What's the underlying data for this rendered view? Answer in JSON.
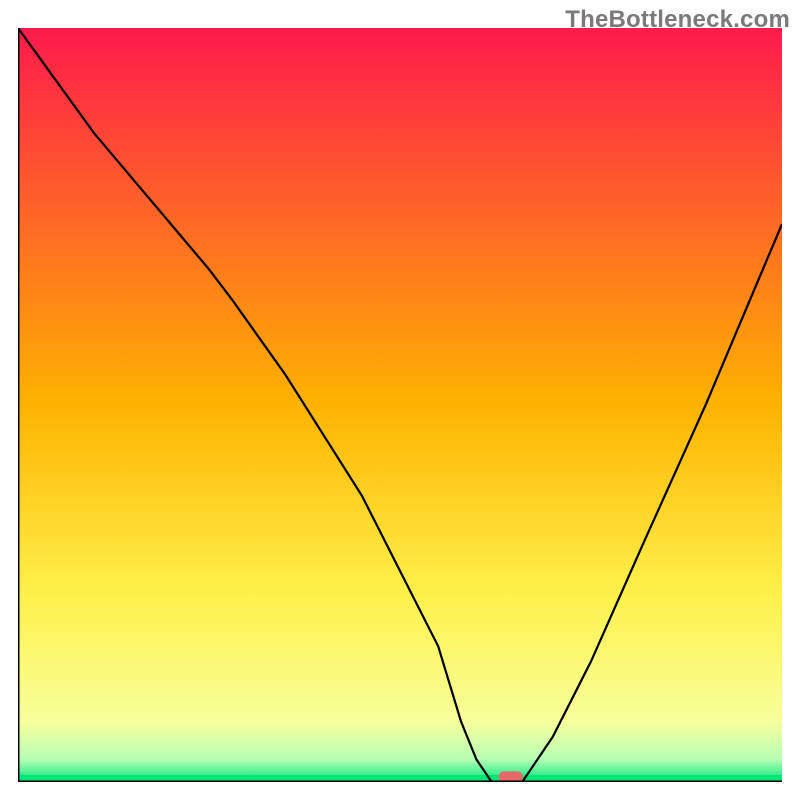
{
  "watermark": "TheBottleneck.com",
  "chart_data": {
    "type": "line",
    "title": "",
    "xlabel": "",
    "ylabel": "",
    "xlim": [
      0,
      100
    ],
    "ylim": [
      0,
      100
    ],
    "grid": false,
    "legend": false,
    "background": {
      "type": "vertical-gradient",
      "stops": [
        {
          "pos": 0.0,
          "color": "#ff1a4c"
        },
        {
          "pos": 0.5,
          "color": "#ffb300"
        },
        {
          "pos": 0.75,
          "color": "#fff14a"
        },
        {
          "pos": 0.92,
          "color": "#f7ff9c"
        },
        {
          "pos": 0.97,
          "color": "#b6ffb6"
        },
        {
          "pos": 1.0,
          "color": "#00e676"
        }
      ]
    },
    "series": [
      {
        "name": "bottleneck-curve",
        "color": "#000000",
        "x": [
          0,
          5,
          10,
          15,
          20,
          25,
          28,
          35,
          45,
          55,
          58,
          60,
          62,
          63,
          66,
          70,
          75,
          82,
          90,
          100
        ],
        "y": [
          100,
          93,
          86,
          80,
          74,
          68,
          64,
          54,
          38,
          18,
          8,
          3,
          0,
          0,
          0,
          6,
          16,
          32,
          50,
          74
        ]
      }
    ],
    "marker": {
      "name": "optimal-marker",
      "x": 64.5,
      "y": 0,
      "width": 3.2,
      "height": 1.4,
      "rx": 0.7,
      "color": "#e76a6a"
    }
  }
}
